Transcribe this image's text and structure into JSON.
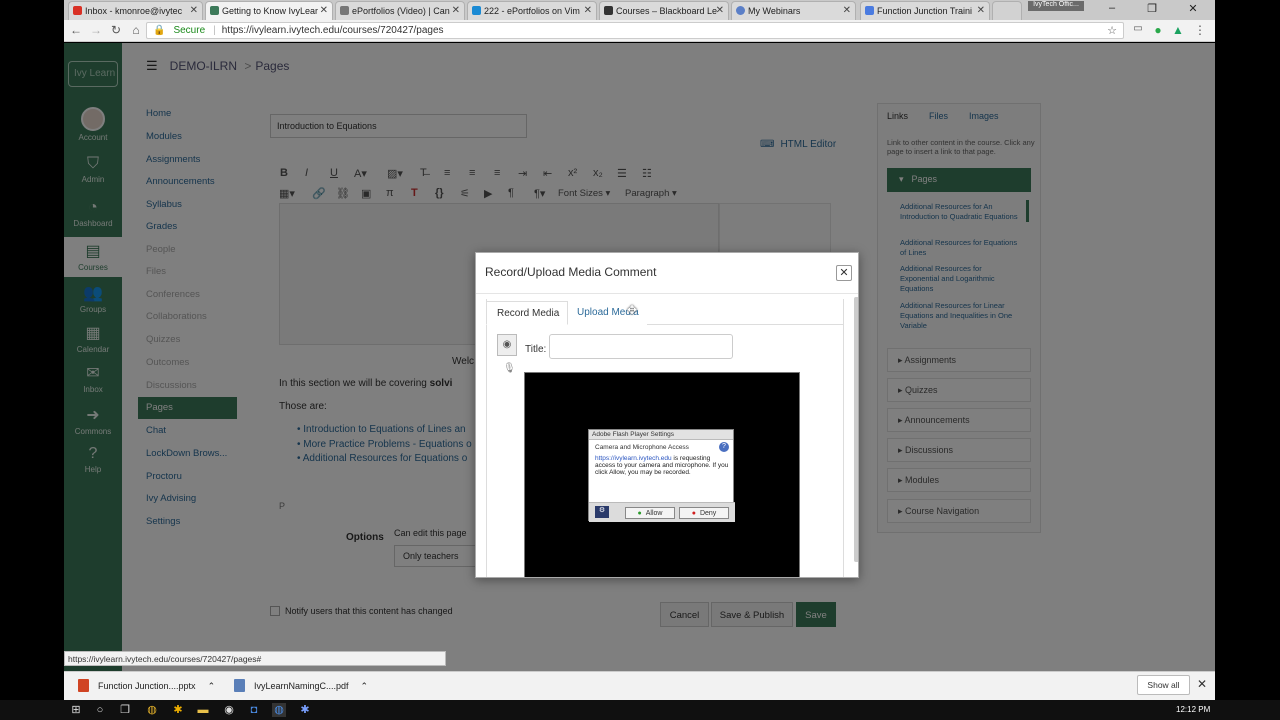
{
  "browser": {
    "tabs": [
      {
        "label": "Inbox - kmonroe@ivytec",
        "favicon_color": "#d93025"
      },
      {
        "label": "Getting to Know IvyLear",
        "favicon_color": "#3d7a5a"
      },
      {
        "label": "ePortfolios (Video) | Can",
        "favicon_color": "#777777"
      },
      {
        "label": "222 - ePortfolios on Vim",
        "favicon_color": "#1a8ad4"
      },
      {
        "label": "Courses – Blackboard Le",
        "favicon_color": "#333333"
      },
      {
        "label": "My Webinars",
        "favicon_color": "#5b7fc7"
      },
      {
        "label": "Function Junction Traini",
        "favicon_color": "#4a7be0"
      }
    ],
    "profile_label": "IvyTech Offic...",
    "secure_label": "Secure",
    "url": "https://ivylearn.ivytech.edu/courses/720427/pages",
    "status_url": "https://ivylearn.ivytech.edu/courses/720427/pages#"
  },
  "lms": {
    "logo": "Ivy Learn",
    "global_nav": [
      {
        "label": "Account",
        "icon": "avatar"
      },
      {
        "label": "Admin",
        "icon": "shield"
      },
      {
        "label": "Dashboard",
        "icon": "dashboard"
      },
      {
        "label": "Courses",
        "icon": "book"
      },
      {
        "label": "Groups",
        "icon": "groups"
      },
      {
        "label": "Calendar",
        "icon": "calendar"
      },
      {
        "label": "Inbox",
        "icon": "inbox"
      },
      {
        "label": "Commons",
        "icon": "commons"
      },
      {
        "label": "Help",
        "icon": "help"
      }
    ],
    "breadcrumb": {
      "course": "DEMO-ILRN",
      "separator": ">",
      "page": "Pages"
    },
    "course_nav": [
      {
        "label": "Home",
        "state": "link"
      },
      {
        "label": "Modules",
        "state": "link"
      },
      {
        "label": "Assignments",
        "state": "link"
      },
      {
        "label": "Announcements",
        "state": "link"
      },
      {
        "label": "Syllabus",
        "state": "link"
      },
      {
        "label": "Grades",
        "state": "link"
      },
      {
        "label": "People",
        "state": "dim"
      },
      {
        "label": "Files",
        "state": "dim"
      },
      {
        "label": "Conferences",
        "state": "dim"
      },
      {
        "label": "Collaborations",
        "state": "dim"
      },
      {
        "label": "Quizzes",
        "state": "dim"
      },
      {
        "label": "Outcomes",
        "state": "dim"
      },
      {
        "label": "Discussions",
        "state": "dim"
      },
      {
        "label": "Pages",
        "state": "selected"
      },
      {
        "label": "Chat",
        "state": "link"
      },
      {
        "label": "LockDown Brows...",
        "state": "link"
      },
      {
        "label": "Proctoru",
        "state": "link"
      },
      {
        "label": "Ivy Advising",
        "state": "link"
      },
      {
        "label": "Settings",
        "state": "link"
      }
    ],
    "page_title_value": "Introduction to Equations",
    "html_editor_label": "HTML Editor",
    "toolbar": {
      "font_sizes": "Font Sizes",
      "paragraph": "Paragraph"
    },
    "editor": {
      "welcome_fragment": "Welc",
      "intro_line": "In this section we will be covering",
      "intro_bold": "solvi",
      "those_are": "Those are:",
      "bullets": [
        "Introduction to Equations of Lines an",
        "More Practice Problems - Equations o",
        "Additional Resources for Equations o"
      ],
      "path_label": "P"
    },
    "options_label": "Options",
    "options_desc": "Can edit this page",
    "options_value": "Only teachers",
    "notify_label": "Notify users that this content has changed",
    "buttons": {
      "cancel": "Cancel",
      "save_publish": "Save & Publish",
      "save": "Save"
    },
    "sidebar": {
      "tabs": [
        "Links",
        "Files",
        "Images"
      ],
      "desc": "Link to other content in the course. Click any page to insert a link to that page.",
      "pages_header": "Pages",
      "page_links": [
        "Additional Resources for An Introduction to Quadratic Equations",
        "Additional Resources for Equations of Lines",
        "Additional Resources for Exponential and Logarithmic Equations",
        "Additional Resources for Linear Equations and Inequalities in One Variable"
      ],
      "accordions": [
        "Assignments",
        "Quizzes",
        "Announcements",
        "Discussions",
        "Modules",
        "Course Navigation"
      ]
    }
  },
  "modal": {
    "title": "Record/Upload Media Comment",
    "tabs": {
      "record": "Record Media",
      "upload": "Upload Media"
    },
    "title_label": "Title:",
    "title_value": "",
    "flash": {
      "header": "Adobe Flash Player Settings",
      "subheader": "Camera and Microphone Access",
      "url": "https://ivylearn.ivytech.edu",
      "body": " is requesting access to your camera and microphone. If you click Allow, you may be recorded.",
      "allow": "Allow",
      "deny": "Deny"
    }
  },
  "downloads": [
    {
      "name": "Function Junction....pptx",
      "color": "#d04423"
    },
    {
      "name": "IvyLearnNamingC....pdf",
      "color": "#5a7fb8"
    }
  ],
  "downloads_show_all": "Show all",
  "clock": "12:12 PM"
}
